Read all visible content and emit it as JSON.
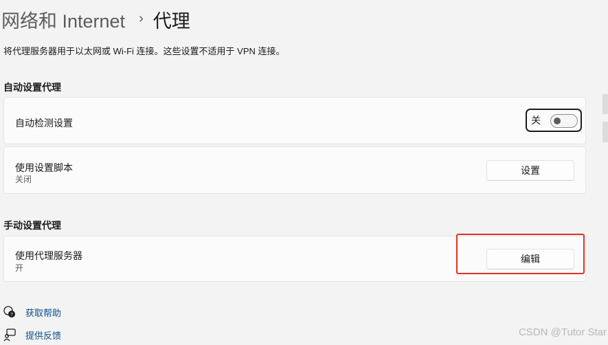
{
  "breadcrumb": {
    "parent": "网络和 Internet",
    "separator": "›",
    "current": "代理"
  },
  "description": "将代理服务器用于以太网或 Wi-Fi 连接。这些设置不适用于 VPN 连接。",
  "auto_section": {
    "title": "自动设置代理",
    "detect": {
      "label": "自动检测设置",
      "toggle_state_label": "关",
      "toggle_on": false
    },
    "script": {
      "label": "使用设置脚本",
      "status": "关闭",
      "button_label": "设置"
    }
  },
  "manual_section": {
    "title": "手动设置代理",
    "proxy": {
      "label": "使用代理服务器",
      "status": "开",
      "button_label": "编辑"
    }
  },
  "links": [
    {
      "label": "获取帮助",
      "icon": "help-icon"
    },
    {
      "label": "提供反馈",
      "icon": "feedback-icon"
    }
  ],
  "watermark": "CSDN @Tutor Star",
  "colors": {
    "background": "#f3f3f3",
    "card": "#fbfbfb",
    "link": "#0b4f8c",
    "highlight": "#e0312a"
  }
}
